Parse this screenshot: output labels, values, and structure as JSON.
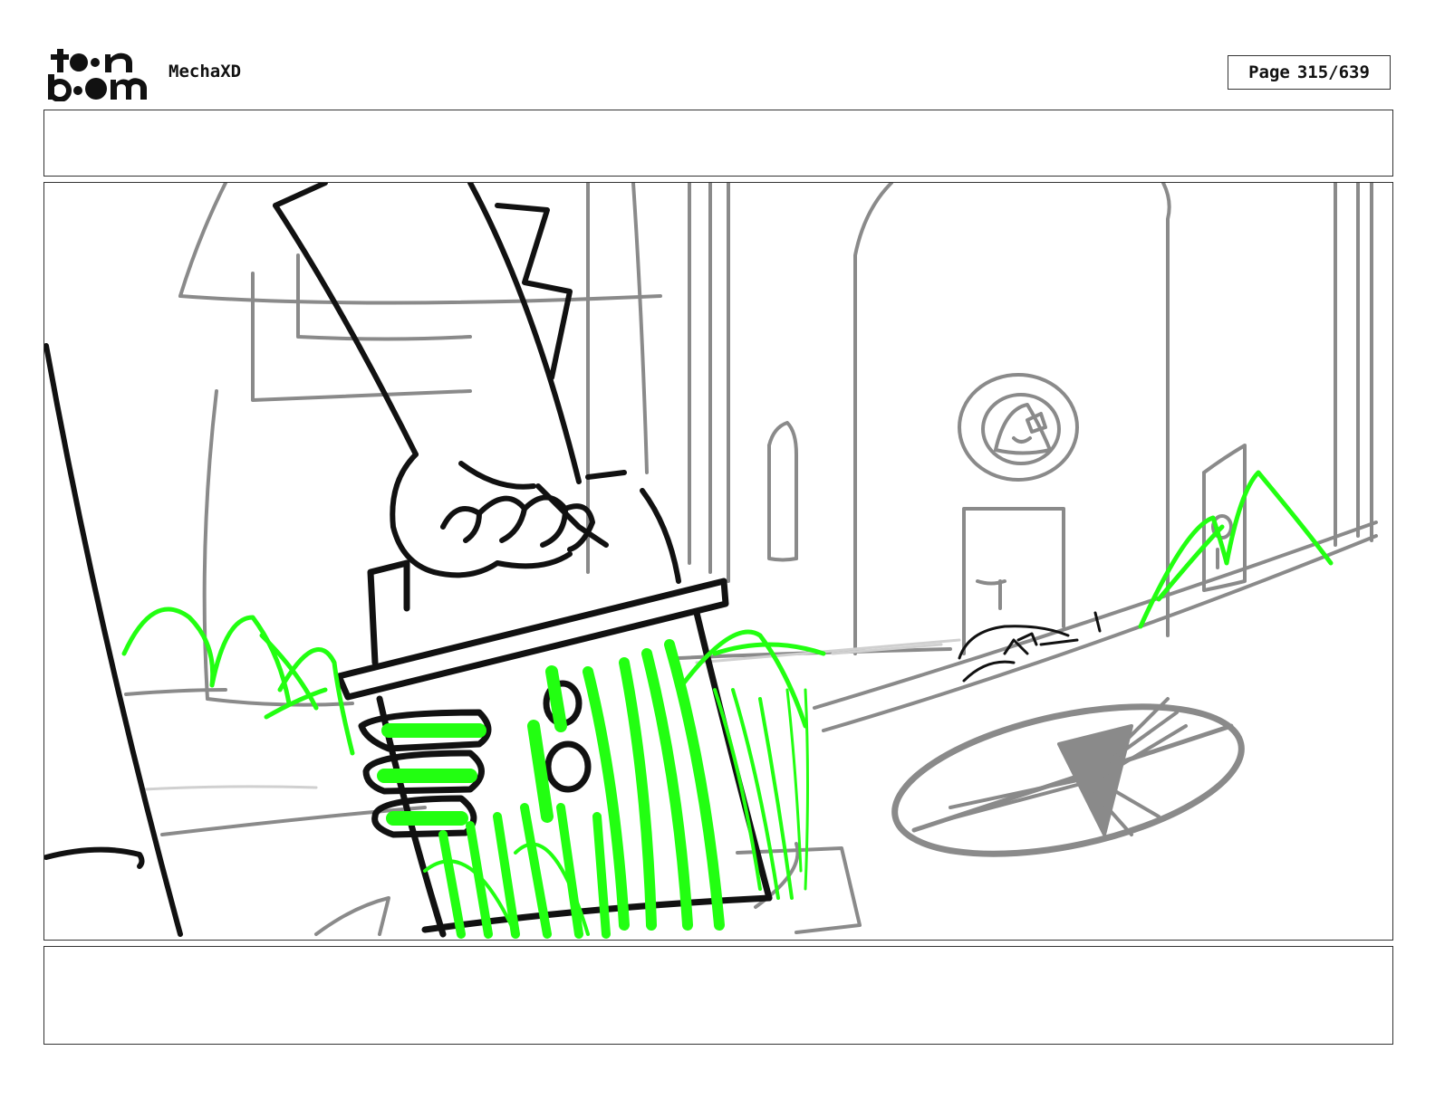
{
  "header": {
    "logo_text_top": "toon",
    "logo_text_bottom": "boom",
    "project_title": "MechaXD",
    "page_label": "Page",
    "page_number": "315/639"
  },
  "panel": {
    "action_notes": "",
    "dialogue": ""
  },
  "colors": {
    "sketch_black": "#111111",
    "sketch_gray": "#8a8a8a",
    "sketch_light_gray": "#cfcfcf",
    "highlight_green": "#22ff11"
  }
}
